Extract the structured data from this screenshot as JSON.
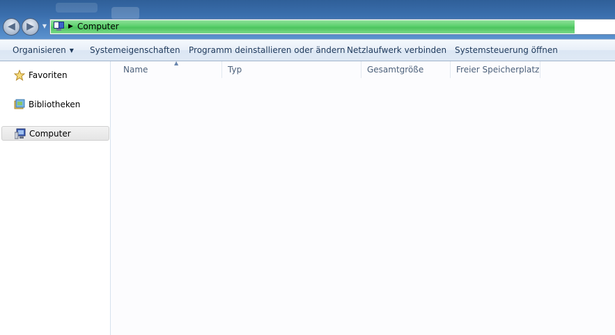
{
  "address": {
    "location": "Computer"
  },
  "toolbar": {
    "organize": "Organisieren",
    "system_properties": "Systemeigenschaften",
    "uninstall": "Programm deinstallieren oder ändern",
    "map_drive": "Netzlaufwerk verbinden",
    "control_panel": "Systemsteuerung öffnen"
  },
  "nav": {
    "items": [
      {
        "label": "Favoriten",
        "icon": "star-icon"
      },
      {
        "label": "Bibliotheken",
        "icon": "libraries-icon"
      },
      {
        "label": "Computer",
        "icon": "computer-icon",
        "selected": true
      }
    ]
  },
  "columns": [
    "Name",
    "Typ",
    "Gesamtgröße",
    "Freier Speicherplatz"
  ],
  "colors": {
    "progress": "#5cd06d",
    "titlebar": "#3b6fae",
    "text": "#1e395b"
  }
}
